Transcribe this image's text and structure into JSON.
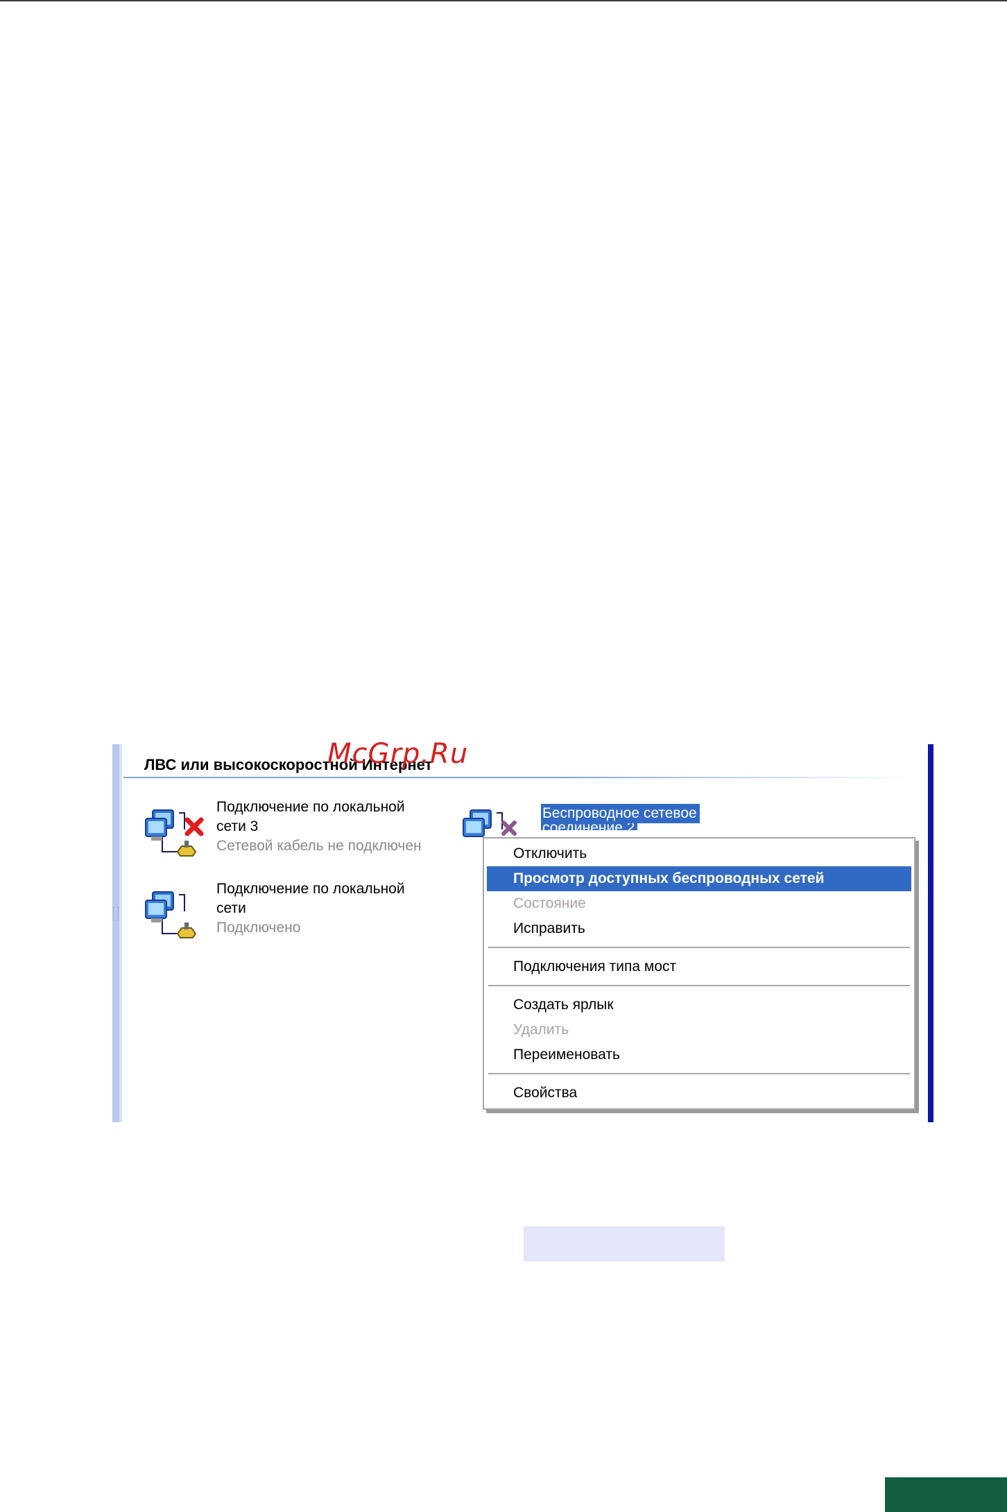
{
  "watermark": "McGrp.Ru",
  "panel": {
    "group_title": "ЛВС или высокоскоростной Интернет",
    "connections": [
      {
        "name_line1": "Подключение по локальной",
        "name_line2": "сети 3",
        "status": "Сетевой кабель не подключен",
        "icon": "network-computer-disconnected-icon"
      },
      {
        "name_line1": "Подключение по локальной",
        "name_line2": "сети",
        "status": "Подключено",
        "icon": "network-computer-icon"
      },
      {
        "name_line1": "Беспроводное сетевое",
        "name_line2": "соединение 2",
        "icon": "wireless-network-computer-icon",
        "selected": true
      }
    ]
  },
  "context_menu": {
    "items": [
      {
        "label": "Отключить",
        "state": "normal"
      },
      {
        "label": "Просмотр доступных беспроводных сетей",
        "state": "selected-default"
      },
      {
        "label": "Состояние",
        "state": "disabled"
      },
      {
        "label": "Исправить",
        "state": "normal"
      },
      {
        "label": "Подключения типа мост",
        "state": "normal"
      },
      {
        "label": "Создать ярлык",
        "state": "normal"
      },
      {
        "label": "Удалить",
        "state": "disabled"
      },
      {
        "label": "Переименовать",
        "state": "normal"
      },
      {
        "label": "Свойства",
        "state": "normal"
      }
    ]
  },
  "colors": {
    "selection": "#316ac5",
    "panel_right_bar": "#0e17a3",
    "watermark": "#d62020",
    "corner_tab": "#125e3f",
    "highlight_box": "#e6e6fb"
  }
}
